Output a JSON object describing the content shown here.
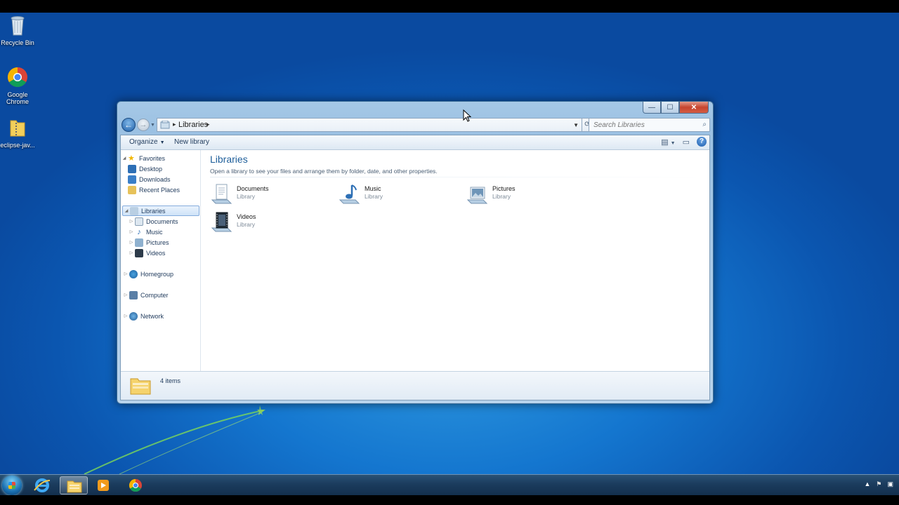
{
  "desktop": {
    "icons": [
      {
        "label": "Recycle Bin",
        "icon": "recycle-bin-icon"
      },
      {
        "label": "Google Chrome",
        "icon": "chrome-icon"
      },
      {
        "label": "eclipse-jav...",
        "icon": "zip-folder-icon"
      }
    ]
  },
  "window": {
    "caption_buttons": {
      "minimize": "—",
      "maximize": "☐",
      "close": "✕"
    },
    "address": {
      "crumb": "Libraries"
    },
    "search": {
      "placeholder": "Search Libraries"
    },
    "command_bar": {
      "organize": "Organize",
      "new_library": "New library"
    },
    "nav_pane": {
      "favorites": {
        "label": "Favorites",
        "items": [
          "Desktop",
          "Downloads",
          "Recent Places"
        ]
      },
      "libraries": {
        "label": "Libraries",
        "items": [
          "Documents",
          "Music",
          "Pictures",
          "Videos"
        ]
      },
      "homegroup": "Homegroup",
      "computer": "Computer",
      "network": "Network"
    },
    "content": {
      "title": "Libraries",
      "subtitle": "Open a library to see your files and arrange them by folder, date, and other properties.",
      "items": [
        {
          "name": "Documents",
          "type": "Library",
          "icon": "documents-library-icon"
        },
        {
          "name": "Music",
          "type": "Library",
          "icon": "music-library-icon"
        },
        {
          "name": "Pictures",
          "type": "Library",
          "icon": "pictures-library-icon"
        },
        {
          "name": "Videos",
          "type": "Library",
          "icon": "videos-library-icon"
        }
      ]
    },
    "details": {
      "count": "4 items"
    }
  },
  "taskbar": {
    "items": [
      "start-orb",
      "internet-explorer",
      "windows-explorer",
      "windows-media-player",
      "google-chrome"
    ]
  },
  "colors": {
    "accent": "#1e5e9a",
    "desktop": "#1476cf"
  }
}
